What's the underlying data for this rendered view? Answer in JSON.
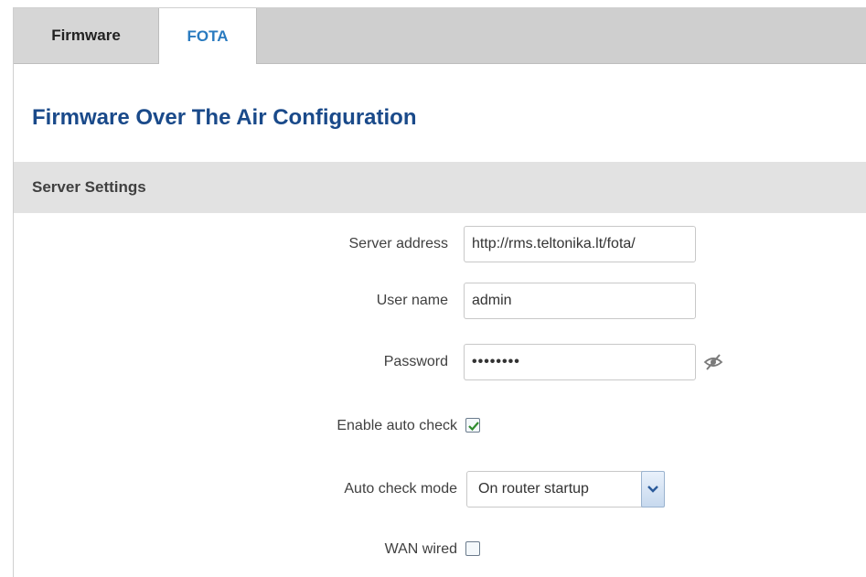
{
  "tabs": [
    {
      "label": "Firmware",
      "active": false
    },
    {
      "label": "FOTA",
      "active": true
    }
  ],
  "page_title": "Firmware Over The Air Configuration",
  "section": {
    "title": "Server Settings"
  },
  "fields": {
    "server_address": {
      "label": "Server address",
      "value": "http://rms.teltonika.lt/fota/"
    },
    "user_name": {
      "label": "User name",
      "value": "admin"
    },
    "password": {
      "label": "Password",
      "value": "••••••••"
    },
    "enable_auto_check": {
      "label": "Enable auto check",
      "checked": true
    },
    "auto_check_mode": {
      "label": "Auto check mode",
      "value": "On router startup"
    },
    "wan_wired": {
      "label": "WAN wired",
      "checked": false
    }
  },
  "colors": {
    "accent": "#2a7bc0",
    "title": "#1a4a8a",
    "check": "#2e8b2e"
  },
  "icons": {
    "password_toggle": "eye-slash-icon",
    "dropdown": "chevron-down-icon"
  }
}
